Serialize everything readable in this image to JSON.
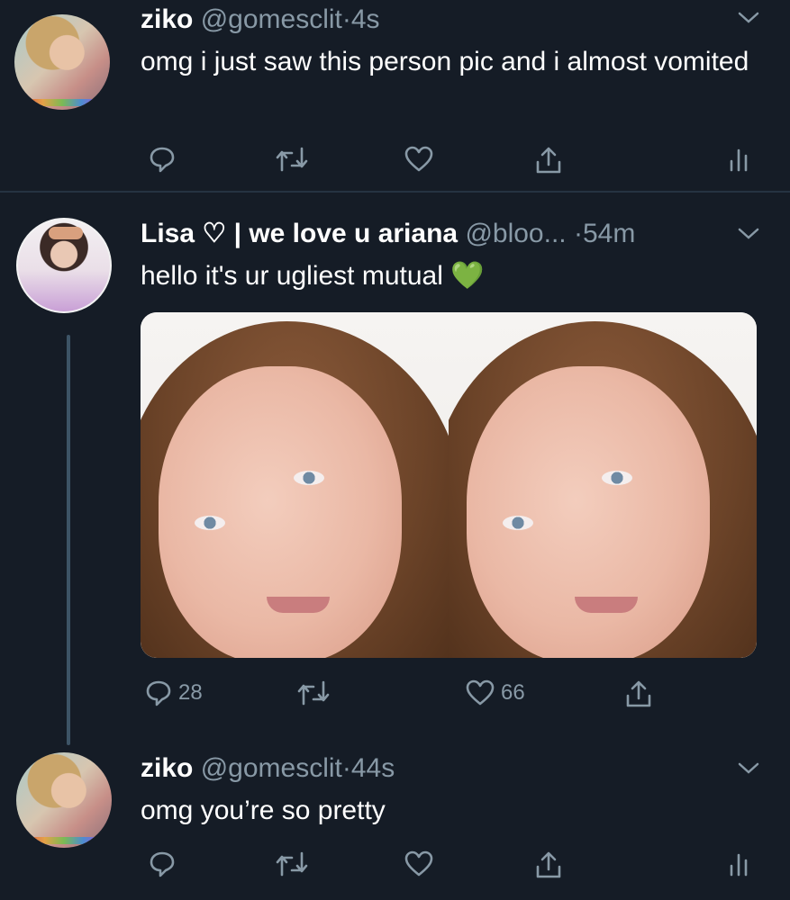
{
  "tweets": [
    {
      "name": "ziko",
      "handle": "@gomesclit",
      "dot": "·",
      "time": "4s",
      "text": "omg i just saw this person pic and i almost vomited",
      "actions": {
        "reply": "",
        "retweet": "",
        "like": "",
        "share": ""
      }
    },
    {
      "name": "Lisa ♡ | we love u ariana",
      "handle": "@bloo...",
      "dot": "·",
      "time": "54m",
      "text": "hello it's ur ugliest mutual",
      "emoji": "💚",
      "actions": {
        "reply": "28",
        "retweet": "",
        "like": "66",
        "share": ""
      }
    },
    {
      "name": "ziko",
      "handle": "@gomesclit",
      "dot": "·",
      "time": "44s",
      "text": "omg you’re so pretty",
      "actions": {
        "reply": "",
        "retweet": "",
        "like": "",
        "share": ""
      }
    }
  ],
  "icons": {
    "reply": "reply-icon",
    "retweet": "retweet-icon",
    "like": "heart-icon",
    "share": "share-icon",
    "analytics": "analytics-icon",
    "more": "chevron-down-icon"
  },
  "colors": {
    "background": "#151c26",
    "secondary_text": "#8899a6",
    "divider": "#253341",
    "thread_line": "#3d5466",
    "emoji_green": "#5cc93d"
  }
}
